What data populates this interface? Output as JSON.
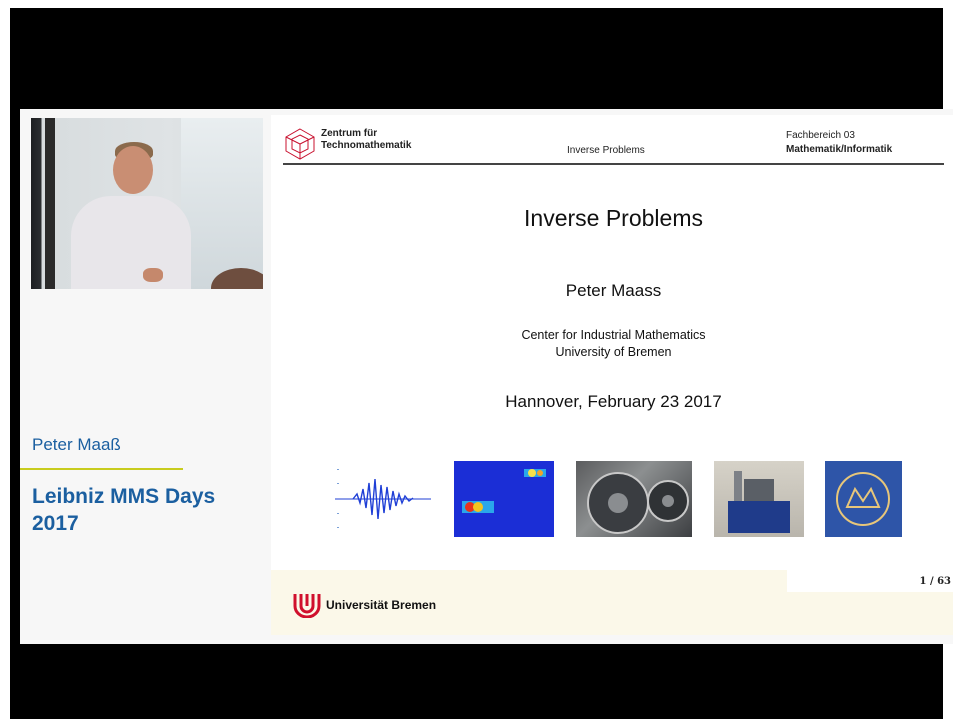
{
  "left_panel": {
    "speaker_name": "Peter Maaß",
    "event_title": "Leibniz MMS Days\n2017"
  },
  "slide": {
    "header": {
      "logo_text": "Zentrum für\nTechnomathematik",
      "center": "Inverse Problems",
      "dept_line1": "Fachbereich  03",
      "dept_line2": "Mathematik/Informatik"
    },
    "title": "Inverse Problems",
    "author": "Peter Maass",
    "institution_line1": "Center for Industrial Mathematics",
    "institution_line2": "University of Bremen",
    "place_date": "Hannover, February 23 2017",
    "images": [
      "signal",
      "heatmap",
      "jet-engine",
      "machine",
      "seal"
    ],
    "page_number": "1 / 63",
    "footer": {
      "university": "Universität Bremen"
    }
  },
  "colors": {
    "accent": "#1b5fa0",
    "rule": "#c8cc1e",
    "ub_red": "#d0102d"
  }
}
